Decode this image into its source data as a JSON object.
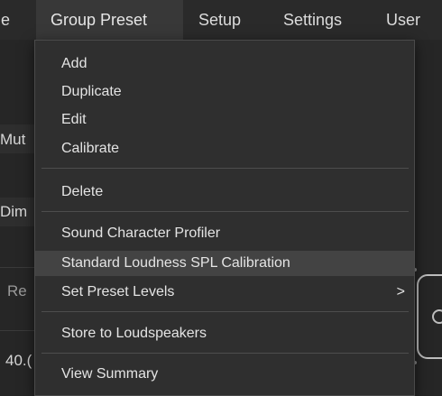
{
  "menubar": {
    "items": [
      {
        "label": "e"
      },
      {
        "label": "Group Preset"
      },
      {
        "label": "Setup"
      },
      {
        "label": "Settings"
      },
      {
        "label": "User"
      }
    ]
  },
  "background": {
    "mute_label": "Mut",
    "dim_label": "Dim",
    "re_label": "Re",
    "value_label": "40.("
  },
  "group_preset_menu": {
    "items": [
      {
        "label": "Add"
      },
      {
        "label": "Duplicate"
      },
      {
        "label": "Edit"
      },
      {
        "label": "Calibrate"
      },
      {
        "label": "Delete"
      },
      {
        "label": "Sound Character Profiler"
      },
      {
        "label": "Standard Loudness SPL Calibration"
      },
      {
        "label": "Set Preset Levels",
        "submenu_indicator": ">"
      },
      {
        "label": "Store to Loudspeakers"
      },
      {
        "label": "View Summary"
      }
    ]
  }
}
